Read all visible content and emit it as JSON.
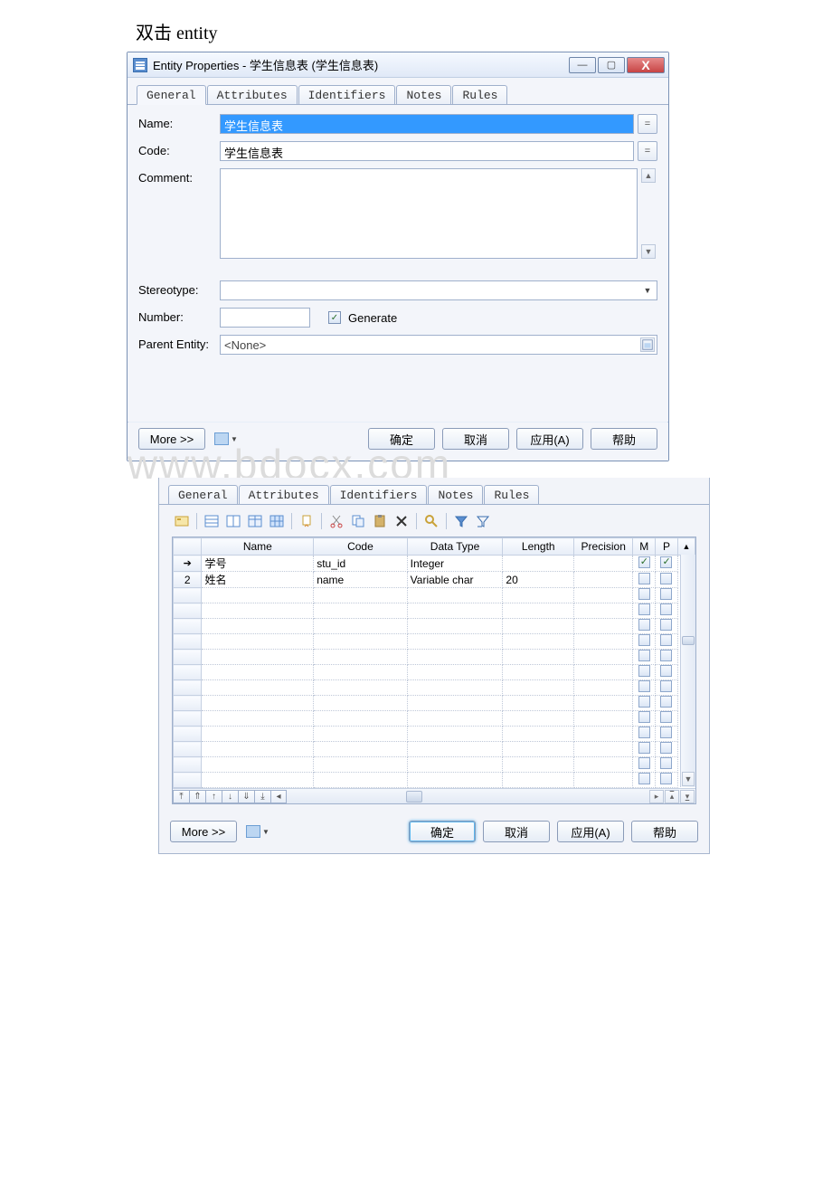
{
  "caption": "双击 entity",
  "dialog1": {
    "title": "Entity Properties - 学生信息表 (学生信息表)",
    "tabs": {
      "general": "General",
      "attributes": "Attributes",
      "identifiers": "Identifiers",
      "notes": "Notes",
      "rules": "Rules"
    },
    "fields": {
      "name_label": "Name:",
      "name_value": "学生信息表",
      "code_label": "Code:",
      "code_value": "学生信息表",
      "comment_label": "Comment:",
      "comment_value": "",
      "stereotype_label": "Stereotype:",
      "stereotype_value": "",
      "number_label": "Number:",
      "number_value": "",
      "generate_label": "Generate",
      "parent_label": "Parent Entity:",
      "parent_value": "<None>"
    },
    "buttons": {
      "more": "More >>",
      "ok": "确定",
      "cancel": "取消",
      "apply": "应用(A)",
      "help": "帮助"
    },
    "sqbtn": "="
  },
  "watermark": "www.bdocx.com",
  "dialog2": {
    "tabs": {
      "general": "General",
      "attributes": "Attributes",
      "identifiers": "Identifiers",
      "notes": "Notes",
      "rules": "Rules"
    },
    "grid": {
      "headers": {
        "name": "Name",
        "code": "Code",
        "datatype": "Data Type",
        "length": "Length",
        "precision": "Precision",
        "m": "M",
        "p": "P"
      },
      "rows": [
        {
          "idx_arrow": true,
          "idx": "",
          "name": "学号",
          "code": "stu_id",
          "datatype": "Integer",
          "length": "",
          "precision": "",
          "m": true,
          "p": true
        },
        {
          "idx_arrow": false,
          "idx": "2",
          "name": "姓名",
          "code": "name",
          "datatype": "Variable char",
          "length": "20",
          "precision": "",
          "m": false,
          "p": false
        }
      ]
    },
    "buttons": {
      "more": "More >>",
      "ok": "确定",
      "cancel": "取消",
      "apply": "应用(A)",
      "help": "帮助"
    }
  }
}
